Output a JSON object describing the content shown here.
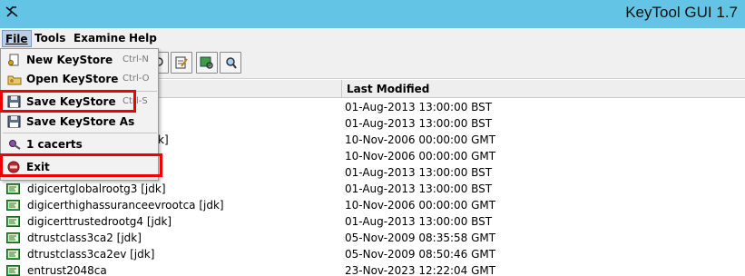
{
  "window": {
    "title": "KeyTool GUI 1.7"
  },
  "menubar": [
    {
      "label": "File",
      "active": true
    },
    {
      "label": "Tools"
    },
    {
      "label": "Examine"
    },
    {
      "label": "Help"
    }
  ],
  "file_menu": {
    "items": [
      {
        "label": "New KeyStore",
        "accelerator": "Ctrl-N",
        "icon": "new-keystore-icon"
      },
      {
        "label": "Open KeyStore",
        "accelerator": "Ctrl-O",
        "icon": "open-folder-icon"
      },
      {
        "label": "Save KeyStore",
        "accelerator": "Ctrl-S",
        "icon": "save-icon",
        "highlighted": true
      },
      {
        "label": "Save KeyStore As",
        "accelerator": "",
        "icon": "save-as-icon"
      },
      {
        "label": "1 cacerts",
        "accelerator": "",
        "icon": "recent-keystore-icon"
      },
      {
        "label": "Exit",
        "accelerator": "",
        "icon": "exit-icon",
        "highlighted": true
      }
    ],
    "highlight_color": "#ee0000"
  },
  "table": {
    "columns": [
      "Last Modified"
    ],
    "rows": [
      {
        "alias": "",
        "last_modified": "01-Aug-2013 13:00:00 BST"
      },
      {
        "alias": "",
        "last_modified": "01-Aug-2013 13:00:00 BST"
      },
      {
        "alias": "k]",
        "last_modified": "10-Nov-2006 00:00:00 GMT"
      },
      {
        "alias": "",
        "last_modified": "10-Nov-2006 00:00:00 GMT"
      },
      {
        "alias": "",
        "last_modified": "01-Aug-2013 13:00:00 BST"
      },
      {
        "alias": "digicertglobalrootg3 [jdk]",
        "last_modified": "01-Aug-2013 13:00:00 BST"
      },
      {
        "alias": "digicerthighassuranceevrootca [jdk]",
        "last_modified": "10-Nov-2006 00:00:00 GMT"
      },
      {
        "alias": "digicerttrustedrootg4 [jdk]",
        "last_modified": "01-Aug-2013 13:00:00 BST"
      },
      {
        "alias": "dtrustclass3ca2 [jdk]",
        "last_modified": "05-Nov-2009 08:35:58 GMT"
      },
      {
        "alias": "dtrustclass3ca2ev [jdk]",
        "last_modified": "05-Nov-2009 08:50:46 GMT"
      },
      {
        "alias": "entrust2048ca",
        "last_modified": "23-Nov-2023 12:22:04 GMT"
      }
    ]
  },
  "colors": {
    "titlebar": "#63c4e6",
    "menu_active": "#b8cfe5",
    "highlight": "#ee0000",
    "cert_icon": "#2e8b3a"
  }
}
